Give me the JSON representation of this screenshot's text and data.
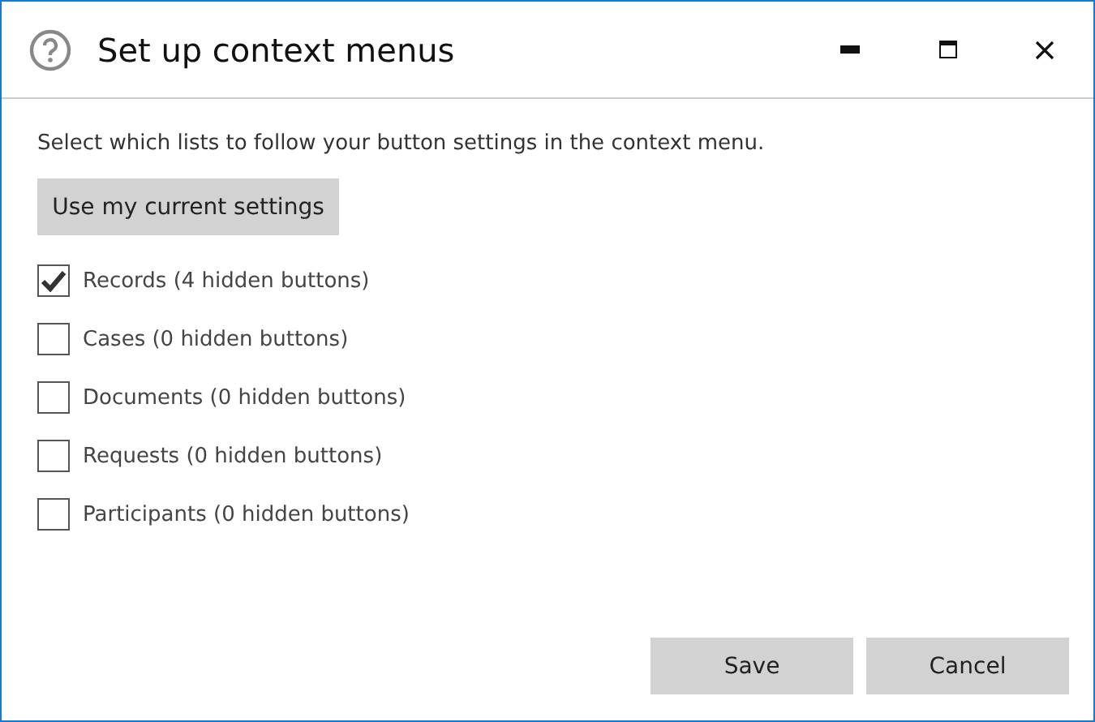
{
  "window": {
    "title": "Set up context menus"
  },
  "instruction": "Select which lists to follow your button settings in the context menu.",
  "use_current_button": "Use my current settings",
  "lists": [
    {
      "label": "Records (4 hidden buttons)",
      "checked": true
    },
    {
      "label": "Cases (0 hidden buttons)",
      "checked": false
    },
    {
      "label": "Documents (0 hidden buttons)",
      "checked": false
    },
    {
      "label": "Requests (0 hidden buttons)",
      "checked": false
    },
    {
      "label": "Participants (0 hidden buttons)",
      "checked": false
    }
  ],
  "buttons": [
    "Save",
    "Cancel"
  ]
}
